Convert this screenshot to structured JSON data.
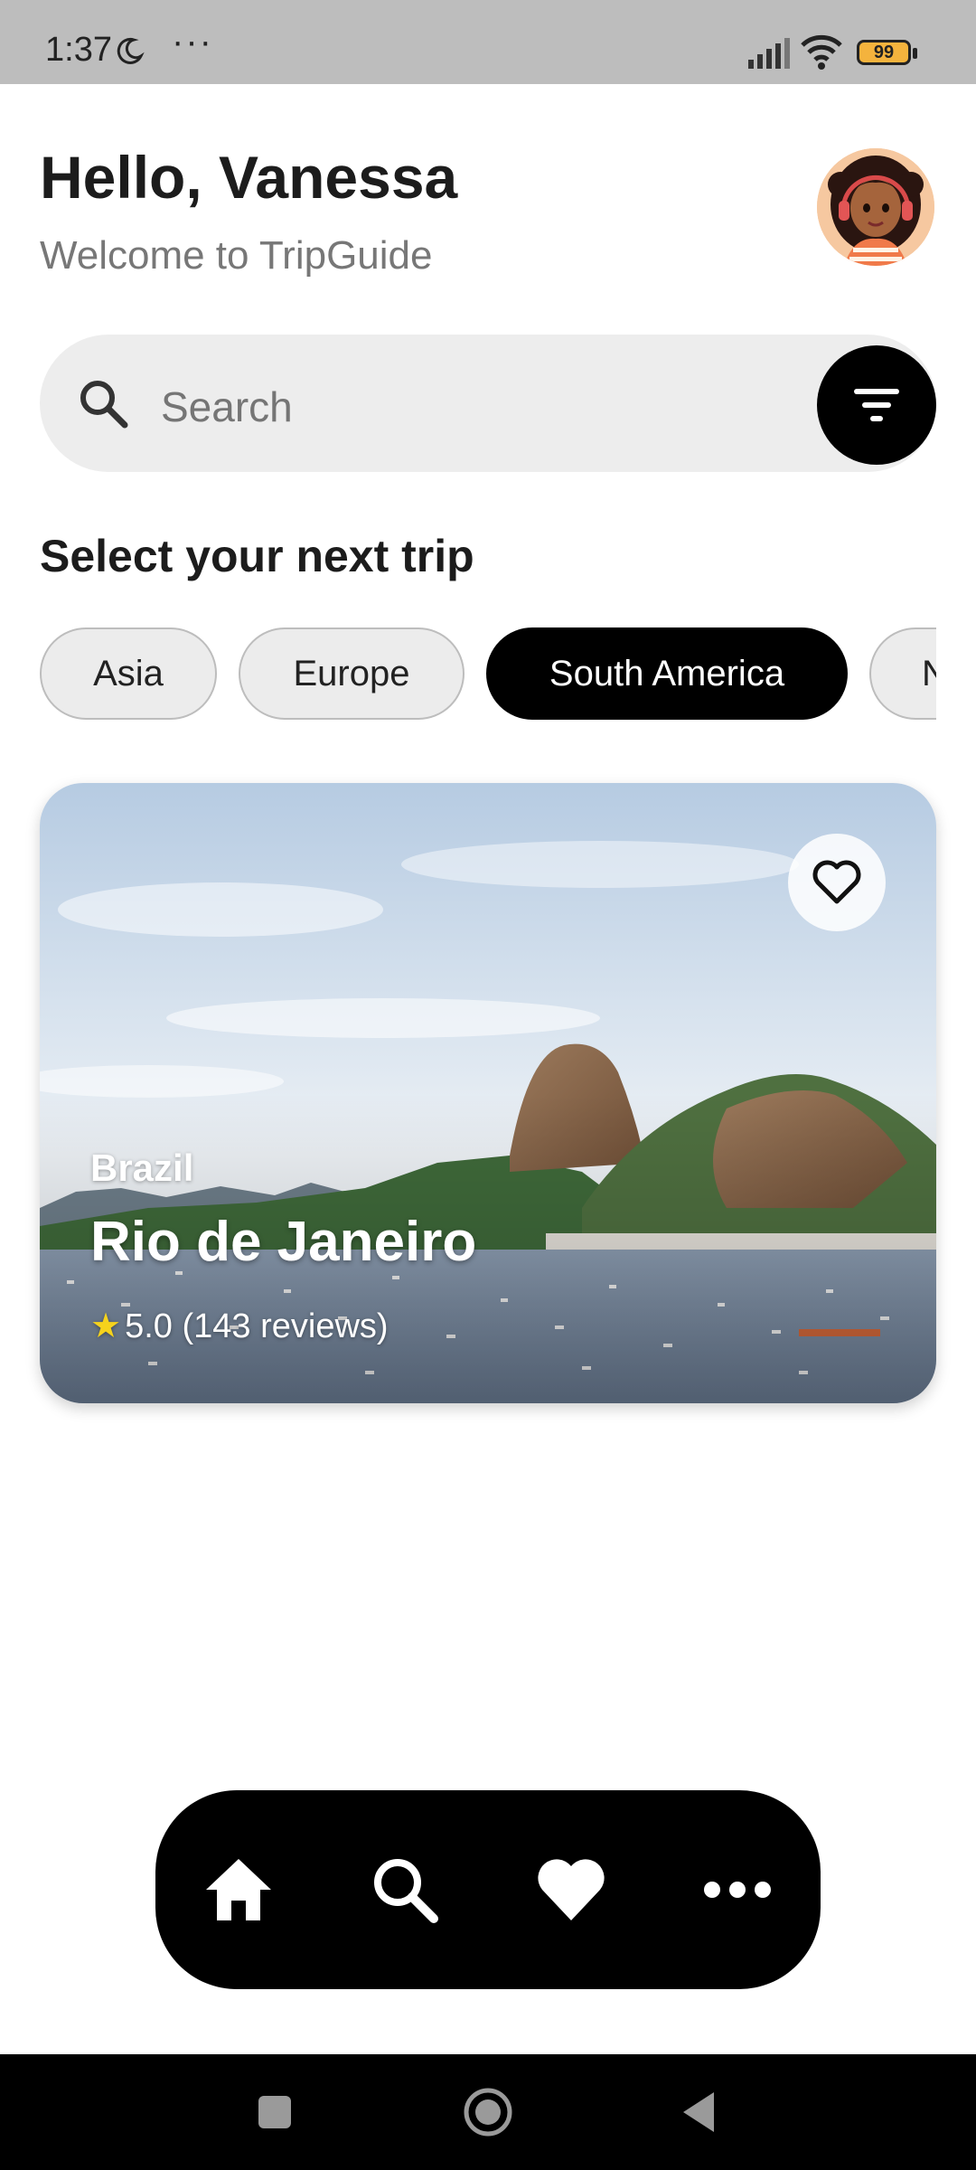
{
  "status_bar": {
    "time": "1:37",
    "dots": "···",
    "battery": "99"
  },
  "header": {
    "greeting": "Hello, Vanessa",
    "subtitle": "Welcome to TripGuide"
  },
  "search": {
    "placeholder": "Search"
  },
  "section_title": "Select your next trip",
  "chips": [
    {
      "label": "Asia",
      "active": false
    },
    {
      "label": "Europe",
      "active": false
    },
    {
      "label": "South America",
      "active": true
    },
    {
      "label": "N",
      "active": false
    }
  ],
  "card": {
    "country": "Brazil",
    "city": "Rio de Janeiro",
    "rating": "5.0",
    "reviews": "(143 reviews)"
  },
  "bottom_nav": [
    {
      "icon": "home-icon"
    },
    {
      "icon": "search-icon"
    },
    {
      "icon": "heart-icon"
    },
    {
      "icon": "more-icon"
    }
  ],
  "colors": {
    "accent": "#000000",
    "chip_bg": "#ececec",
    "star": "#f6d31c"
  }
}
